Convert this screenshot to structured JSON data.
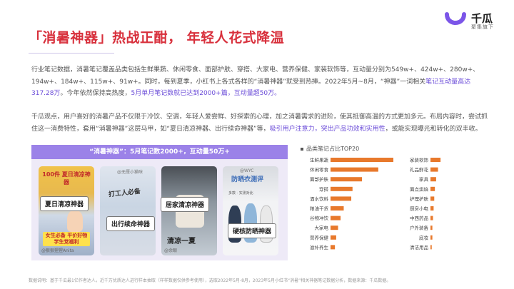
{
  "header": {
    "title": "「消暑神器」热战正酣， 年轻人花式降温"
  },
  "logo": {
    "name": "千瓜",
    "sub": "聚集旗下"
  },
  "paragraph1": {
    "text_a": "行业笔记数据，消暑笔记覆盖品类包括生鲜果蔬、休闲零食、面部护肤、穿搭、大家电、营养保健、家装软饰等，互动量分别为549w+、424w+、280w+、194w+、184w+、115w+、91w+。同时，每到夏季，小红书上各式各样的“消暑神器”就受到热捧。2022年5月~8月，“神器”一词相关",
    "highlight_1": "笔记互动量高达317.28万",
    "text_b": "。今年依然保持高热度，",
    "highlight_2": "5月单月笔记数就已达到2000+篇，互动量超50万。"
  },
  "paragraph2": {
    "text_a": "千瓜观点，用户喜好的消暑产品不仅限于冷饮、空调，年轻人爱尝鲜、好探索的心理，加之消暑需求的进阶，使其抵御高温的方式更加多元。布局内容时，尝试抓住这一消费特性，套用“消暑神器”这层马甲，如“夏日清凉神器、出行续命神器”等，",
    "highlight": "吸引用户注意力，突出产品功效和实用性",
    "text_b": "，或能实现曝光和转化的双丰收。"
  },
  "left_panel": {
    "header": "“消暑神器”：5月笔记数2000+，互动量50万+",
    "cards": [
      {
        "sticker_top": "100件 夏日清凉神器",
        "label": "夏日清凉神器",
        "sticker_bottom": "女生必备 平价好物 学生党福利",
        "caption": "@狠狠猩猩Anita"
      },
      {
        "watermark": "@无厘小猫咪",
        "body": "打工人必备",
        "label": "出行续命神器"
      },
      {
        "label": "居家清凉神器",
        "body": "清凉一夏",
        "caption": "@余眼"
      },
      {
        "watermark": "@WYC",
        "body": "防晒衣测评",
        "sub": "多款 · 实测对比",
        "label": "硬核防晒神器"
      }
    ]
  },
  "right_chart": {
    "title": "品类笔记占比TOP20"
  },
  "chart_data": {
    "type": "bar",
    "title": "品类笔记占比TOP20",
    "orientation": "horizontal",
    "series": [
      {
        "categories": [
          "生鲜果蔬",
          "休闲零食",
          "面部护肤",
          "穿搭",
          "酒水饮料",
          "粮油干货",
          "谷物冲饮",
          "大家电",
          "营养保健",
          "滋补养生"
        ],
        "values": [
          100,
          76,
          50,
          35,
          33,
          21,
          16,
          12,
          9,
          7
        ]
      },
      {
        "categories": [
          "家装软饰",
          "礼品鲜花",
          "家具",
          "面点烘焙",
          "护理护肤",
          "厨房小电",
          "中西药品",
          "户外装备",
          "底妆",
          "清洁用品"
        ],
        "values": [
          16,
          12,
          9,
          7,
          6,
          5,
          4,
          3,
          3,
          2
        ]
      }
    ],
    "colors": {
      "bar": "#e8792c",
      "label": "#444444"
    }
  },
  "footer": {
    "text": "数据说明：基于千瓜最1亿作者达人，近千万优质达人进行样本抽取（样样数据仅供参考使用），选取2022年5月-8月，2023年5月小红书“消暑”相关神器笔记数据分析，数据来源：千瓜数据。"
  }
}
